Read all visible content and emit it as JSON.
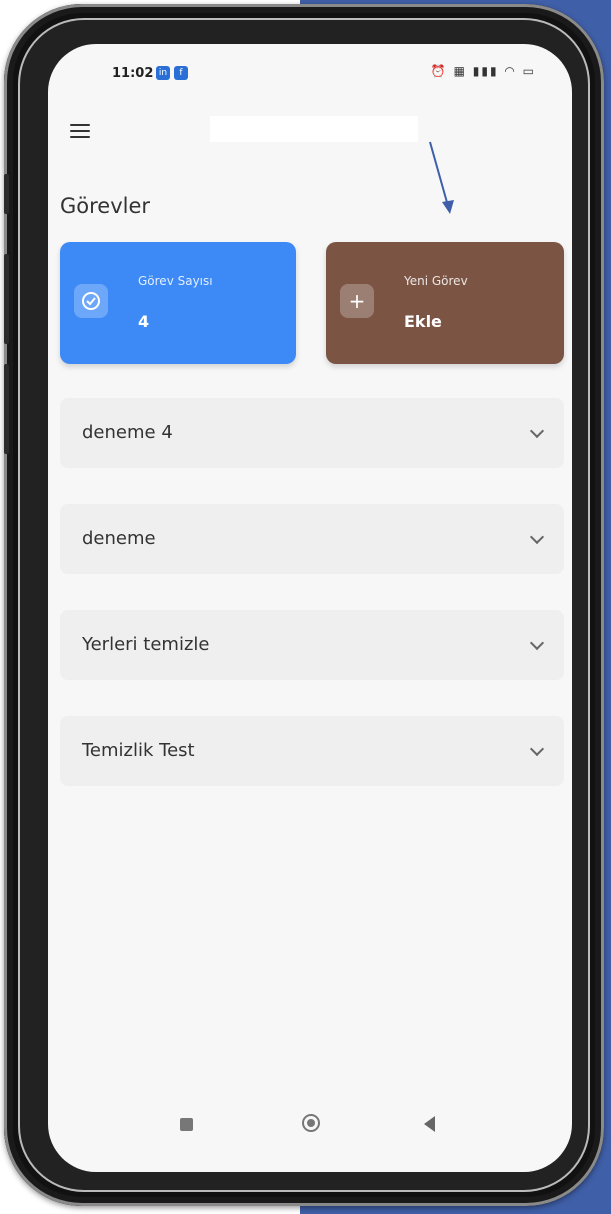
{
  "status_bar": {
    "time": "11:02",
    "badges": [
      "in",
      "f"
    ]
  },
  "page": {
    "title": "Görevler"
  },
  "cards": {
    "task_count": {
      "label": "Görev Sayısı",
      "value": "4"
    },
    "new_task": {
      "label": "Yeni Görev",
      "value": "Ekle",
      "icon": "+"
    }
  },
  "tasks": [
    {
      "label": "deneme 4"
    },
    {
      "label": "deneme"
    },
    {
      "label": "Yerleri temizle"
    },
    {
      "label": "Temizlik Test"
    }
  ],
  "colors": {
    "count_card": "#3d8af7",
    "new_card": "#7b5444",
    "annotation_arrow": "#3f5fa8"
  }
}
